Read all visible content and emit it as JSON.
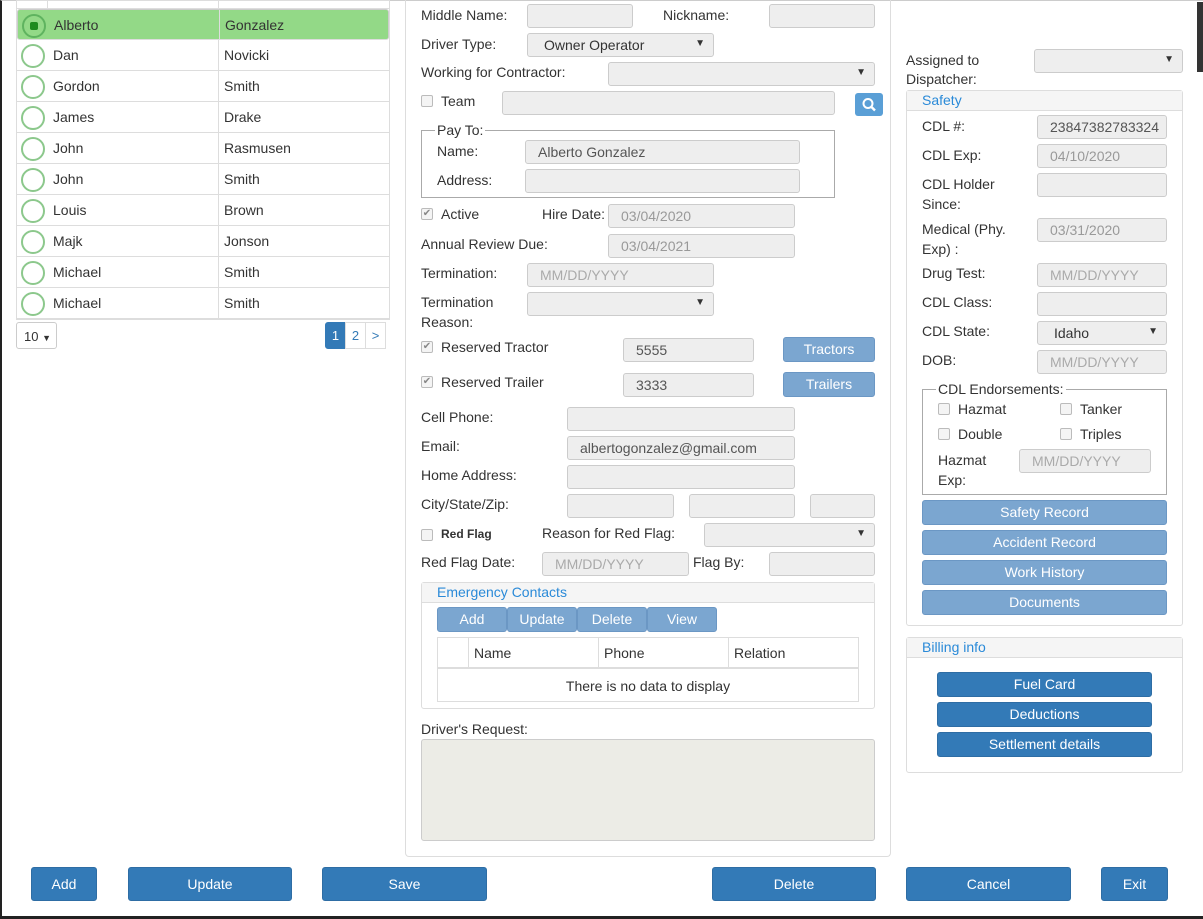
{
  "drivers": {
    "rows": [
      {
        "first": "Alberto",
        "last": "Gonzalez",
        "selected": true
      },
      {
        "first": "Dan",
        "last": "Novicki",
        "selected": false
      },
      {
        "first": "Gordon",
        "last": "Smith",
        "selected": false
      },
      {
        "first": "James",
        "last": "Drake",
        "selected": false
      },
      {
        "first": "John",
        "last": "Rasmusen",
        "selected": false
      },
      {
        "first": "John",
        "last": "Smith",
        "selected": false
      },
      {
        "first": "Louis",
        "last": "Brown",
        "selected": false
      },
      {
        "first": "Majk",
        "last": "Jonson",
        "selected": false
      },
      {
        "first": "Michael",
        "last": "Smith",
        "selected": false
      },
      {
        "first": "Michael",
        "last": "Smith",
        "selected": false
      }
    ],
    "page_size": "10",
    "pages": [
      "1",
      "2",
      ">"
    ],
    "current_page": "1"
  },
  "form": {
    "middle_name_label": "Middle Name:",
    "nickname_label": "Nickname:",
    "driver_type_label": "Driver Type:",
    "driver_type_value": "Owner Operator",
    "working_for_contractor_label": "Working for Contractor:",
    "team_label": "Team",
    "pay_to_legend": "Pay To:",
    "pay_name_label": "Name:",
    "pay_name_value": "Alberto Gonzalez",
    "pay_address_label": "Address:",
    "active_label": "Active",
    "hire_date_label": "Hire Date:",
    "hire_date_value": "03/04/2020",
    "annual_review_label": "Annual Review Due:",
    "annual_review_value": "03/04/2021",
    "termination_label": "Termination:",
    "termination_placeholder": "MM/DD/YYYY",
    "termination_reason_label1": "Termination",
    "termination_reason_label2": "Reason:",
    "reserved_tractor_label": "Reserved Tractor",
    "reserved_tractor_value": "5555",
    "tractors_button": "Tractors",
    "reserved_trailer_label": "Reserved Trailer",
    "reserved_trailer_value": "3333",
    "trailers_button": "Trailers",
    "cell_phone_label": "Cell Phone:",
    "email_label": "Email:",
    "email_value": "albertogonzalez@gmail.com",
    "home_address_label": "Home Address:",
    "city_state_zip_label": "City/State/Zip:",
    "red_flag_label": "Red Flag",
    "reason_red_flag_label": "Reason for Red Flag:",
    "red_flag_date_label": "Red Flag Date:",
    "red_flag_date_placeholder": "MM/DD/YYYY",
    "flag_by_label": "Flag By:",
    "drivers_request_label": "Driver's Request:"
  },
  "emergency": {
    "title": "Emergency Contacts",
    "buttons": [
      "Add",
      "Update",
      "Delete",
      "View"
    ],
    "columns": [
      "Name",
      "Phone",
      "Relation"
    ],
    "empty_text": "There is no data to display"
  },
  "right": {
    "assigned_label1": "Assigned to",
    "assigned_label2": "Dispatcher:",
    "safety_title": "Safety",
    "cdl_no_label": "CDL #:",
    "cdl_no_value": "23847382783324",
    "cdl_exp_label": "CDL Exp:",
    "cdl_exp_value": "04/10/2020",
    "cdl_holder_label1": "CDL Holder",
    "cdl_holder_label2": "Since:",
    "medical_label1": "Medical (Phy.",
    "medical_label2": "Exp) :",
    "medical_value": "03/31/2020",
    "drug_test_label": "Drug Test:",
    "drug_test_placeholder": "MM/DD/YYYY",
    "cdl_class_label": "CDL Class:",
    "cdl_state_label": "CDL State:",
    "cdl_state_value": "Idaho",
    "dob_label": "DOB:",
    "dob_placeholder": "MM/DD/YYYY",
    "endorsements_legend": "CDL Endorsements:",
    "hazmat": "Hazmat",
    "tanker": "Tanker",
    "double": "Double",
    "triples": "Triples",
    "hazmat_exp_label1": "Hazmat",
    "hazmat_exp_label2": "Exp:",
    "hazmat_exp_placeholder": "MM/DD/YYYY",
    "safety_buttons": [
      "Safety Record",
      "Accident Record",
      "Work History",
      "Documents"
    ],
    "billing_title": "Billing info",
    "billing_buttons": [
      "Fuel Card",
      "Deductions",
      "Settlement details"
    ]
  },
  "bottom": {
    "add": "Add",
    "update": "Update",
    "save": "Save",
    "delete": "Delete",
    "cancel": "Cancel",
    "exit": "Exit"
  }
}
